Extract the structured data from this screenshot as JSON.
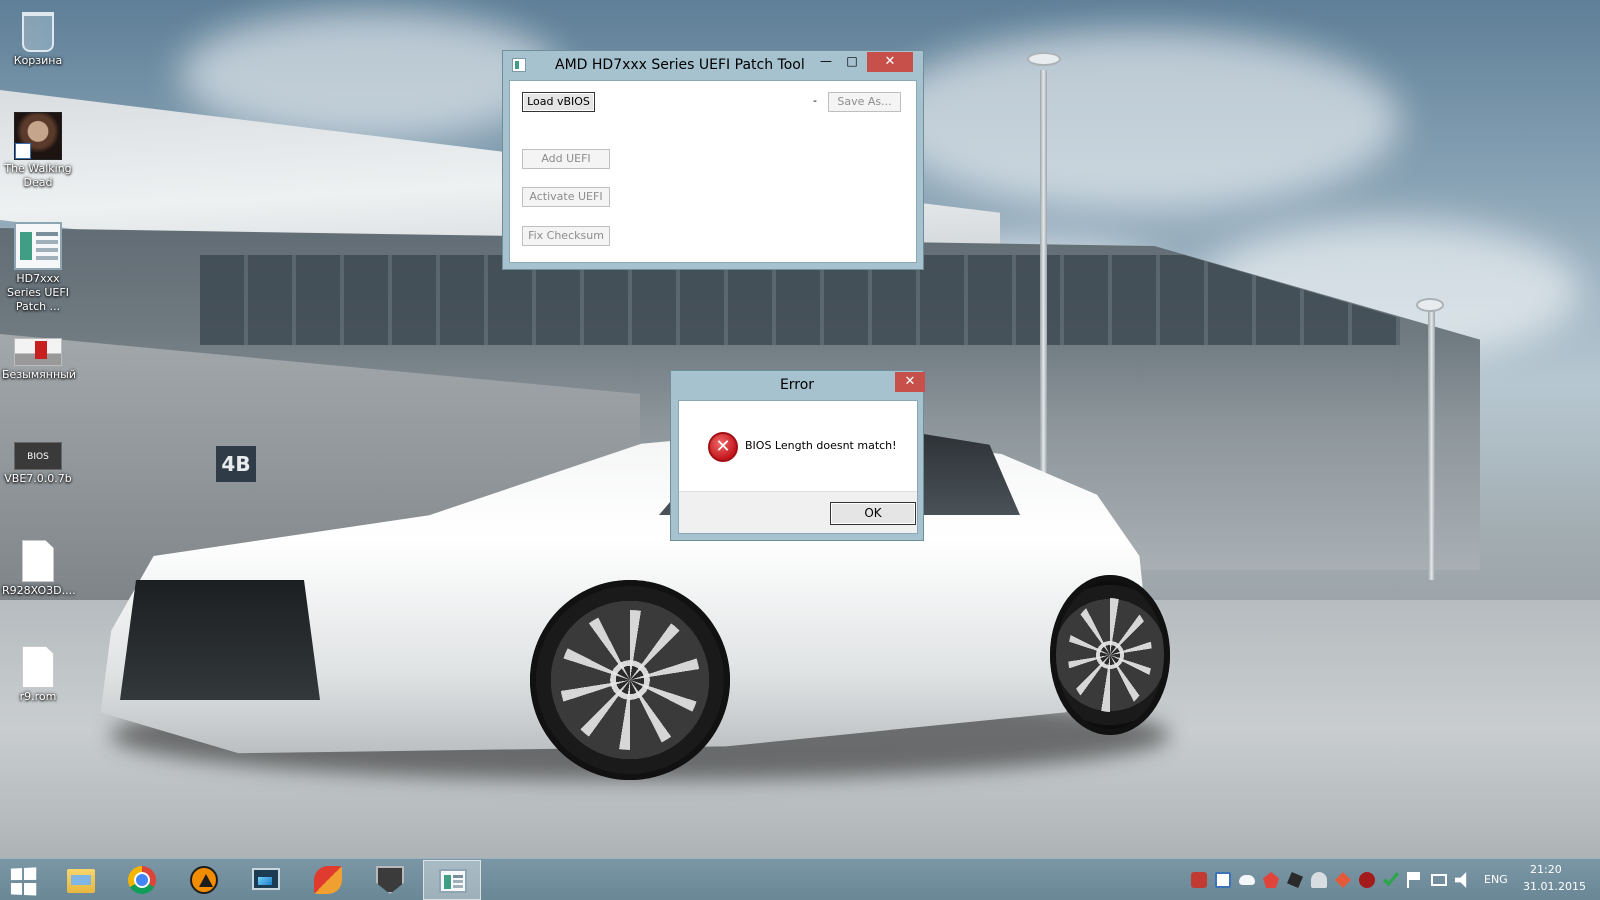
{
  "desktop": {
    "icons": [
      {
        "label": "Корзина",
        "icon": "recycle-bin-icon"
      },
      {
        "label": "The Walking Dead",
        "icon": "walking-dead-game-icon"
      },
      {
        "label": "HD7xxx Series UEFI Patch ...",
        "icon": "uefi-patch-tool-icon"
      },
      {
        "label": "Безымянный",
        "icon": "paint-image-icon"
      },
      {
        "label": "VBE7.0.0.7b",
        "icon": "bios-editor-icon"
      },
      {
        "label": "R928XO3D....",
        "icon": "file-icon"
      },
      {
        "label": "r9.rom",
        "icon": "file-icon"
      }
    ],
    "wallpaper_sign": "4B"
  },
  "main_window": {
    "title": "AMD HD7xxx Series UEFI Patch Tool",
    "controls": {
      "minimize": "—",
      "maximize": "□",
      "close": "✕"
    },
    "load_vbios_label": "Load vBIOS",
    "file_status": "-",
    "save_as_label": "Save As...",
    "add_uefi_label": "Add UEFI",
    "activate_uefi_label": "Activate UEFI",
    "fix_checksum_label": "Fix Checksum"
  },
  "error_dialog": {
    "title": "Error",
    "close": "✕",
    "icon_glyph": "✕",
    "message": "BIOS Length doesnt match!",
    "ok_label": "OK"
  },
  "taskbar": {
    "pinned": [
      "start-icon",
      "file-explorer-icon",
      "chrome-icon",
      "avast-icon",
      "remote-monitor-icon",
      "ccleaner-icon",
      "world-of-tanks-icon",
      "uefi-patch-tool-icon"
    ],
    "tray": {
      "language": "ENG",
      "time": "21:20",
      "date": "31.01.2015"
    }
  },
  "colors": {
    "titlebar": "#a6c2cf",
    "close_button": "#c7504b",
    "taskbar": "#6a8796",
    "error_icon": "#c3161c"
  }
}
